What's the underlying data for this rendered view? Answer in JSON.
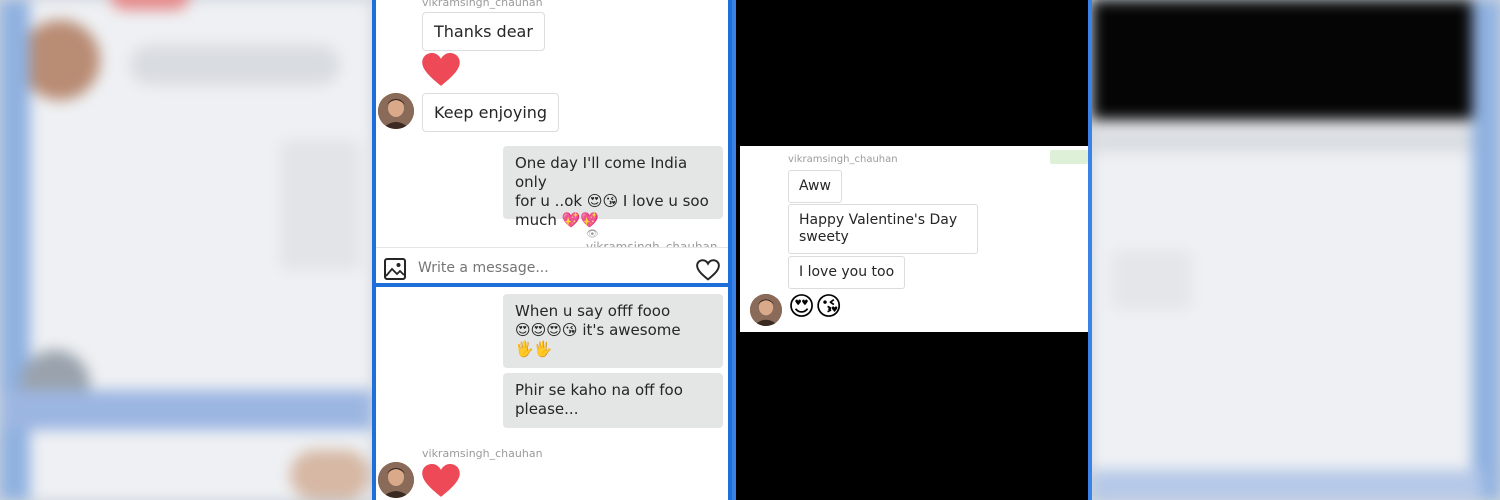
{
  "panel_a": {
    "top_username": "vikramsingh_chauhan",
    "msg_thanks": "Thanks dear",
    "msg_keep": "Keep enjoying",
    "outgoing_line1": "One day I'll come India only",
    "outgoing_line2a": "for u ..ok",
    "outgoing_line2b": "I love u soo",
    "outgoing_line3": "much",
    "seen_by": "vikramsingh_chauhan",
    "composer_placeholder": "Write a message..."
  },
  "panel_b": {
    "outgoing1_line1": "When u say offf fooo",
    "outgoing1_line2": "it's  awesome",
    "outgoing2_line1": "Phir se kaho na off foo",
    "outgoing2_line2": "please...",
    "username": "vikramsingh_chauhan"
  },
  "panel_c": {
    "username": "vikramsingh_chauhan",
    "msg_aww": "Aww",
    "msg_valentine_line1": "Happy Valentine's Day",
    "msg_valentine_line2": "sweety",
    "msg_love": "I love you too"
  },
  "icons": {
    "heart": "heart-icon",
    "gallery": "image-gallery-icon",
    "like": "heart-outline-icon",
    "seen": "eye-icon",
    "emoji_love": "heart-eyes-emoji",
    "emoji_kiss": "kissing-heart-emoji",
    "emoji_hearts": "sparkling-heart-emoji",
    "emoji_hand": "raised-hand-emoji"
  },
  "colors": {
    "frame": "#1e6fd9",
    "heart": "#ed4956",
    "outgoing_bubble": "#e3e6e5"
  }
}
